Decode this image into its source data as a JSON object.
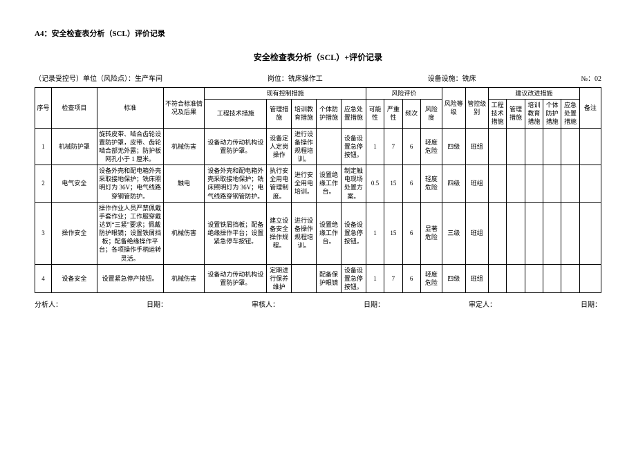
{
  "header": "A4：安全检查表分析（SCL）评价记录",
  "title": "安全检查表分析（SCL）+评价记录",
  "meta": {
    "left": "（记录受控号）单位（风险点）：生产车间",
    "mid": "岗位：铣床操作工",
    "right1": "设备设施：铣床",
    "right2": "№：02"
  },
  "cols": {
    "seq": "序号",
    "item": "检查项目",
    "std": "标准",
    "nonconf": "不符合标准情况及后果",
    "ctrl_group": "现有控制措施",
    "ctrl_eng": "工程技术措施",
    "ctrl_mgmt": "管理措施",
    "ctrl_train": "培训教育措施",
    "ctrl_ppe": "个体防护措施",
    "ctrl_emerg": "应急处置措施",
    "risk_group": "风险评价",
    "risk_poss": "可能性",
    "risk_sev": "严重性",
    "risk_freq": "频次",
    "risk_deg": "风险度",
    "risk_level": "风险等级",
    "ctrl_level": "管控级别",
    "sugg_group": "建议改进措施",
    "sugg_eng": "工程技术措施",
    "sugg_mgmt": "管理措施",
    "sugg_train": "培训教育措施",
    "sugg_ppe": "个体防护措施",
    "sugg_emerg": "应急处置措施",
    "remark": "备注"
  },
  "rows": [
    {
      "seq": "1",
      "item": "机械防护罩",
      "std": "旋转皮带、啮合齿轮设置防护罩，皮带、齿轮啮合部无外露；防护板网孔小于 1 厘米。",
      "nonconf": "机械伤害",
      "ctrl_eng": "设备动力传动机构设置防护罩。",
      "ctrl_mgmt": "设备定人定岗操作",
      "ctrl_train": "进行设备操作规程培训。",
      "ctrl_ppe": "",
      "ctrl_emerg": "设备设置急停按钮。",
      "risk_poss": "1",
      "risk_sev": "7",
      "risk_freq": "6",
      "risk_deg": "轻度危险",
      "risk_level": "四级",
      "ctrl_level": "班组",
      "sugg_eng": "",
      "sugg_mgmt": "",
      "sugg_train": "",
      "sugg_ppe": "",
      "sugg_emerg": "",
      "remark": ""
    },
    {
      "seq": "2",
      "item": "电气安全",
      "std": "设备外壳和配电箱外壳采取接地保护；铣床照明灯为 36V；电气线路穿钢管防护。",
      "nonconf": "触电",
      "ctrl_eng": "设备外壳和配电箱外壳采取接地保护；铣床照明灯为 36V；电气线路穿钢管防护。",
      "ctrl_mgmt": "执行安全用电管理制度。",
      "ctrl_train": "进行安全用电培训。",
      "ctrl_ppe": "设置绝缘工作台。",
      "ctrl_emerg": "制定触电现场处置方案。",
      "risk_poss": "0.5",
      "risk_sev": "15",
      "risk_freq": "6",
      "risk_deg": "轻度危险",
      "risk_level": "四级",
      "ctrl_level": "班组",
      "sugg_eng": "",
      "sugg_mgmt": "",
      "sugg_train": "",
      "sugg_ppe": "",
      "sugg_emerg": "",
      "remark": ""
    },
    {
      "seq": "3",
      "item": "操作安全",
      "std": "操作作业人员严禁佩戴手套作业；工作服穿戴达到“三紧”要求；佩戴防护眼镜；设置铁屑挡板；配备绝缘操作平台；各项操作手柄运转灵活。",
      "nonconf": "机械伤害",
      "ctrl_eng": "设置铁屑挡板；配备绝缘操作平台；设置紧急停车按钮。",
      "ctrl_mgmt": "建立设备安全操作规程。",
      "ctrl_train": "进行设备操作规程培训。",
      "ctrl_ppe": "设置绝缘工作台。",
      "ctrl_emerg": "设备设置急停按钮。",
      "risk_poss": "1",
      "risk_sev": "15",
      "risk_freq": "6",
      "risk_deg": "显著危险",
      "risk_level": "三级",
      "ctrl_level": "班组",
      "sugg_eng": "",
      "sugg_mgmt": "",
      "sugg_train": "",
      "sugg_ppe": "",
      "sugg_emerg": "",
      "remark": ""
    },
    {
      "seq": "4",
      "item": "设备安全",
      "std": "设置紧急停产按钮。",
      "nonconf": "机械伤害",
      "ctrl_eng": "设备动力传动机构设置防护罩。",
      "ctrl_mgmt": "定期进行保养维护",
      "ctrl_train": "",
      "ctrl_ppe": "配备保护眼镜",
      "ctrl_emerg": "设备设置急停按钮。",
      "risk_poss": "1",
      "risk_sev": "7",
      "risk_freq": "6",
      "risk_deg": "轻度危险",
      "risk_level": "四级",
      "ctrl_level": "班组",
      "sugg_eng": "",
      "sugg_mgmt": "",
      "sugg_train": "",
      "sugg_ppe": "",
      "sugg_emerg": "",
      "remark": ""
    }
  ],
  "footer": {
    "analyst": "分析人：",
    "date1": "日期：",
    "reviewer": "审核人：",
    "date2": "日期：",
    "approver": "审定人：",
    "date3": "日期："
  }
}
